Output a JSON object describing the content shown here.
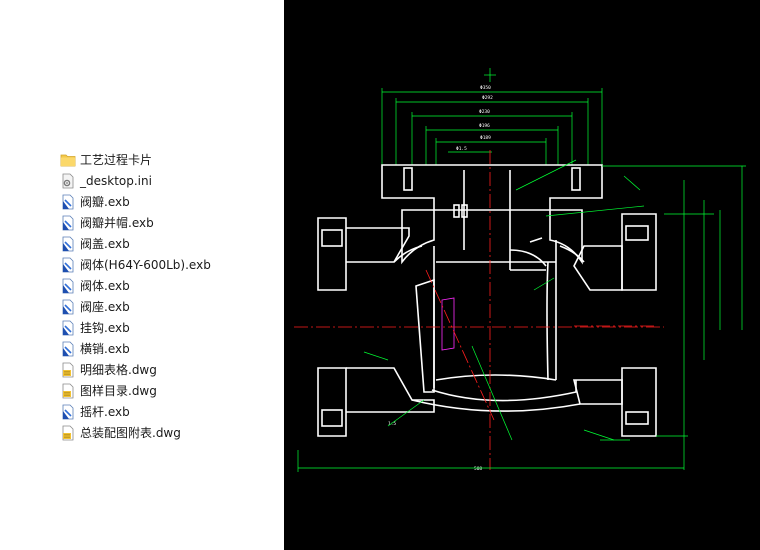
{
  "file_pane": {
    "items": [
      {
        "name": "工艺过程卡片",
        "icon": "folder-icon"
      },
      {
        "name": "_desktop.ini",
        "icon": "settings-file-icon"
      },
      {
        "name": "阀瓣.exb",
        "icon": "exb-file-icon"
      },
      {
        "name": "阀瓣并帽.exb",
        "icon": "exb-file-icon"
      },
      {
        "name": "阀盖.exb",
        "icon": "exb-file-icon"
      },
      {
        "name": "阀体(H64Y-600Lb).exb",
        "icon": "exb-file-icon"
      },
      {
        "name": "阀体.exb",
        "icon": "exb-file-icon"
      },
      {
        "name": "阀座.exb",
        "icon": "exb-file-icon"
      },
      {
        "name": "挂钩.exb",
        "icon": "exb-file-icon"
      },
      {
        "name": "横销.exb",
        "icon": "exb-file-icon"
      },
      {
        "name": "明细表格.dwg",
        "icon": "dwg-file-icon"
      },
      {
        "name": "图样目录.dwg",
        "icon": "dwg-file-icon"
      },
      {
        "name": "摇杆.exb",
        "icon": "exb-file-icon"
      },
      {
        "name": "总装配图附表.dwg",
        "icon": "dwg-file-icon"
      }
    ]
  },
  "drawing": {
    "dims": [
      "Φ350",
      "Φ292",
      "Φ230",
      "Φ196",
      "Φ189",
      "Φ1.5",
      "1:5",
      "508"
    ],
    "colors": {
      "background": "#000000",
      "dimension": "#00ff33",
      "outline": "#ffffff",
      "centerline": "#ff1e1e",
      "detail": "#ff2cff"
    }
  }
}
